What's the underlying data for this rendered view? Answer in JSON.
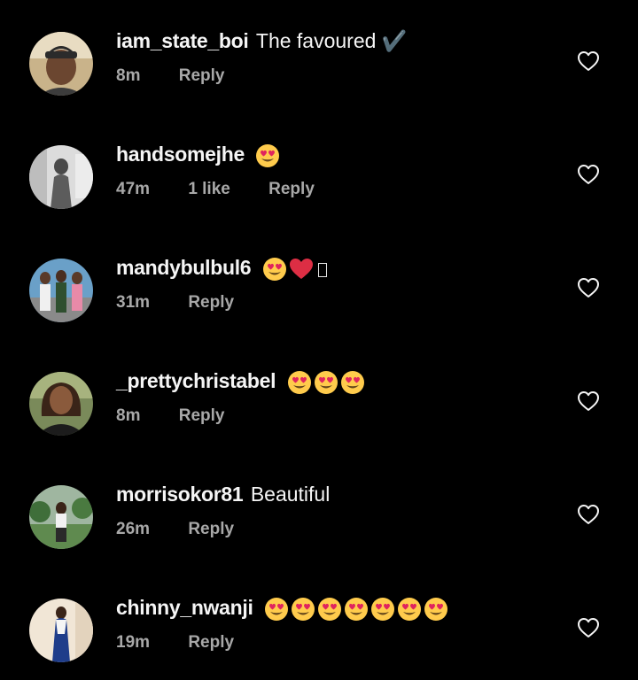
{
  "colors": {
    "background": "#000000",
    "text": "#f5f5f5",
    "meta": "#a8a8a8"
  },
  "comments": [
    {
      "username": "iam_state_boi",
      "message": "The favoured ✔️",
      "emojis": [],
      "time": "8m",
      "likes": "",
      "reply_label": "Reply",
      "like_icon": "heart-outline-icon"
    },
    {
      "username": "handsomejhe",
      "message": "",
      "emojis": [
        "heart-eyes"
      ],
      "time": "47m",
      "likes": "1 like",
      "reply_label": "Reply",
      "like_icon": "heart-outline-icon"
    },
    {
      "username": "mandybulbul6",
      "message": "",
      "emojis": [
        "heart-eyes",
        "red-heart",
        "missing-glyph"
      ],
      "time": "31m",
      "likes": "",
      "reply_label": "Reply",
      "like_icon": "heart-outline-icon"
    },
    {
      "username": "_prettychristabel",
      "message": "",
      "emojis": [
        "heart-eyes",
        "heart-eyes",
        "heart-eyes"
      ],
      "time": "8m",
      "likes": "",
      "reply_label": "Reply",
      "like_icon": "heart-outline-icon"
    },
    {
      "username": "morrisokor81",
      "message": "Beautiful",
      "emojis": [],
      "time": "26m",
      "likes": "",
      "reply_label": "Reply",
      "like_icon": "heart-outline-icon"
    },
    {
      "username": "chinny_nwanji",
      "message": "",
      "emojis": [
        "heart-eyes",
        "heart-eyes",
        "heart-eyes",
        "heart-eyes",
        "heart-eyes",
        "heart-eyes",
        "heart-eyes"
      ],
      "time": "19m",
      "likes": "",
      "reply_label": "Reply",
      "like_icon": "heart-outline-icon"
    }
  ]
}
